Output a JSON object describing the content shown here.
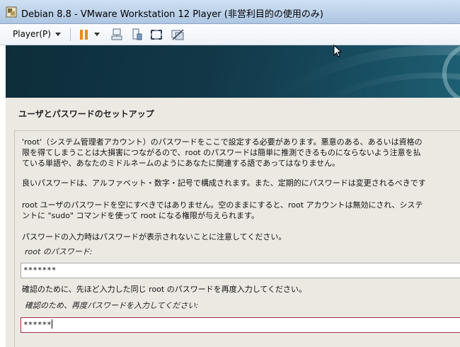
{
  "window": {
    "title": "Debian 8.8 - VMware Workstation 12 Player (非営利目的の使用のみ)"
  },
  "toolbar": {
    "player_menu": "Player(P)"
  },
  "installer": {
    "section_title": "ユーザとパスワードのセットアップ",
    "para1": "'root'（システム管理者アカウント）のパスワードをここで設定する必要があります。悪意のある、あるいは資格の\n限を得てしまうことは大損害につながるので、root のパスワードは簡単に推測できるものにならないよう注意を払\nている単語や、あなたのミドルネームのようにあなたに関連する語であってはなりません。",
    "para2": "良いパスワードは、アルファベット・数字・記号で構成されます。また、定期的にパスワードは変更されるべきです",
    "para3": "root ユーザのパスワードを空にすべきではありません。空のままにすると、root アカウントは無効にされ、システ\nントに \"sudo\" コマンドを使って root になる権限が与えられます。",
    "para4": "パスワードの入力時はパスワードが表示されないことに注意してください。",
    "root_pw_label": "root のパスワード:",
    "root_pw_value": "*******",
    "confirm_note": "確認のために、先ほど入力した同じ root のパスワードを再度入力してください。",
    "confirm_label": "確認のため、再度パスワードを入力してください:",
    "confirm_value": "******"
  },
  "colors": {
    "focus_border": "#a0304a",
    "banner": "#123848"
  },
  "icons": [
    "vmware-app-icon",
    "pause-icon",
    "send-ctrl-alt-del-icon",
    "removable-devices-icon",
    "fullscreen-icon",
    "unity-icon"
  ]
}
